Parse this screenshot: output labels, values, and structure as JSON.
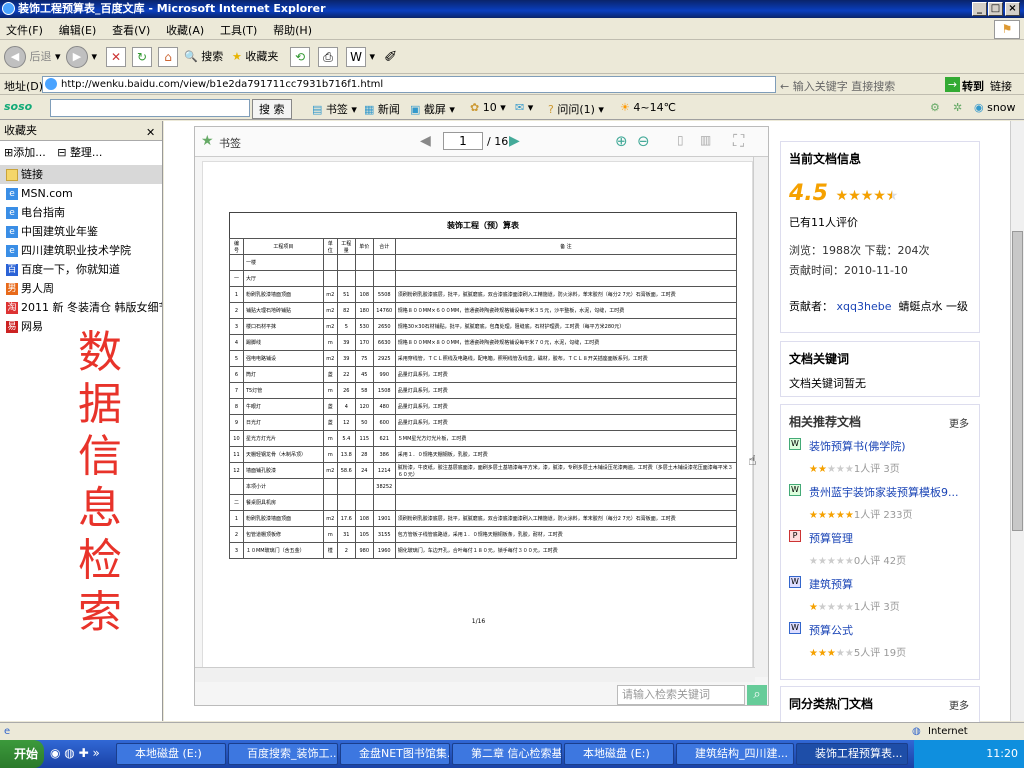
{
  "window": {
    "title": "装饰工程预算表_百度文库 - Microsoft Internet Explorer"
  },
  "menu": [
    "文件(F)",
    "编辑(E)",
    "查看(V)",
    "收藏(A)",
    "工具(T)",
    "帮助(H)"
  ],
  "toolbar": {
    "back": "后退",
    "search": "搜索",
    "favorites": "收藏夹"
  },
  "address": {
    "label": "地址(D)",
    "url": "http://wenku.baidu.com/view/b1e2da791711cc7931b716f1.html",
    "hint": "输入关键字 直接搜索",
    "go": "转到",
    "links": "链接"
  },
  "soso": {
    "logo": "soso",
    "placeholder": "",
    "search_btn": "搜 索",
    "bookmark": "书签",
    "news": "新闻",
    "screenshot": "截屏",
    "count": "10",
    "ask": "问问(1)",
    "weather": "4~14℃",
    "snow": "snow"
  },
  "favorites": {
    "title": "收藏夹",
    "add": "添加...",
    "organize": "整理...",
    "items": [
      "链接",
      "MSN.com",
      "电台指南",
      "中国建筑业年鉴",
      "四川建筑职业技术学院",
      "百度一下，你就知道",
      "男人周",
      "2011 新 冬装清仓 韩版女细节...",
      "网易"
    ]
  },
  "overlay_text": "数据信息检索",
  "viewer": {
    "bookmark": "书签",
    "page": "1",
    "total": "/ 16",
    "search_placeholder": "请输入检索关键词",
    "page_footer": "1/16"
  },
  "doc": {
    "title": "装饰工程（预）算表",
    "headers": [
      "编号",
      "工程项目",
      "单位",
      "工程量",
      "单价",
      "合计",
      "备 注"
    ],
    "rows": [
      [
        "",
        "一楼",
        "",
        "",
        "",
        "",
        ""
      ],
      [
        "一",
        "大厅",
        "",
        "",
        "",
        "",
        ""
      ],
      [
        "1",
        "粉刷乳胶漆墙面顶面",
        "m2",
        "51",
        "108",
        "5508",
        "须刷粉刷乳胶漆底层，批平，腻腻磨底，双合漆底漆面漆刷入工精施道，防火涂料，苯末胶剂（每分2 7元）石膏板面，工时费"
      ],
      [
        "2",
        "铺贴大理石地砖铺贴",
        "m2",
        "82",
        "180",
        "14760",
        "规格８００MM×６００MM，普通瓷砖陶瓷砖规格铺设每平米３５元，沙平整板，水泥，勾缝，工时费"
      ],
      [
        "3",
        "楼口石材平抹",
        "m2",
        "5",
        "530",
        "2650",
        "规格30×30石材铺贴，批平，腻腻磨底，包角处理，阻缝底，石材护理费，工时费（每平方米280元）"
      ],
      [
        "4",
        "踢脚线",
        "m",
        "39",
        "170",
        "6630",
        "规格８００MM×８００MM，普通瓷砖陶瓷砖规格铺设每平米７０元，水泥，勾缝，工时费"
      ],
      [
        "5",
        "强电电路铺设",
        "m2",
        "39",
        "75",
        "2925",
        "采用穿线管，ＴＣＬ照线及电路线，配电箱，照明线管及线盒，磁材，胶布，ＴＣＬ８开关插座面板系列，工时费"
      ],
      [
        "6",
        "筒灯",
        "盏",
        "22",
        "45",
        "990",
        "品量灯具系列，工时费"
      ],
      [
        "7",
        "T5灯管",
        "m",
        "26",
        "58",
        "1508",
        "品量灯具系列，工时费"
      ],
      [
        "8",
        "牛眼灯",
        "盏",
        "4",
        "120",
        "480",
        "品量灯具系列，工时费"
      ],
      [
        "9",
        "日光灯",
        "盏",
        "12",
        "50",
        "600",
        "品量灯具系列，工时费"
      ],
      [
        "10",
        "星光方灯光片",
        "m",
        "5.4",
        "115",
        "621",
        "５MM星光方灯光片板，工时费"
      ],
      [
        "11",
        "天棚轻钢龙骨（木制吊顶）",
        "m",
        "13.8",
        "28",
        "386",
        "采用１．０规格天棚钢板，乳胶，工时费"
      ],
      [
        "12",
        "墙面铺孔胶漆",
        "m2",
        "58.6",
        "24",
        "1214",
        "腻粉漆，牛皮纸，胶注基层底面漆，面刷多层土基墙漆每平方米，漆，腻漆，专刷多层土木铺设压花漆两遍，工时费（多层土木铺设漆花压面漆每平米３６０元）"
      ],
      [
        "",
        "本项小计",
        "",
        "",
        "",
        "38252",
        ""
      ],
      [
        "二",
        "餐桌厨具机房",
        "",
        "",
        "",
        "",
        ""
      ],
      [
        "1",
        "粉刷乳胶漆墙面顶面",
        "m2",
        "17.6",
        "108",
        "1901",
        "须刷粉刷乳胶漆底层，批平，腻腻磨底，双合漆底漆面漆刷入工精施道，防火涂料，苯末胶剂（每分2 7元）石膏板面，工时费"
      ],
      [
        "2",
        "包管道棚顶板修",
        "m",
        "31",
        "105",
        "3155",
        "包方管板子线管底路道，采用１．０规格天棚铜板条，乳胶，耐材，工时费"
      ],
      [
        "3",
        "１０MM玻璃门（含五金）",
        "樘",
        "2",
        "980",
        "1960",
        "钢化玻璃门，车边开孔，合叶每付１８０元，锁手每付３００元，工时费"
      ]
    ]
  },
  "sidebar": {
    "info_title": "当前文档信息",
    "rating": "4.5",
    "rating_fraction": 0.9,
    "rating_count": "已有11人评价",
    "stats": "浏览：1988次   下载：204次",
    "contrib_time": "贡献时间：2010-11-10",
    "contributor_label": "贡献者：",
    "contributor": "xqq3hebe",
    "level": "蜻蜓点水 一级",
    "kw_title": "文档关键词",
    "kw_text": "文档关键词暂无",
    "rec_title": "相关推荐文档",
    "more": "更多",
    "rec": [
      {
        "name": "装饰预算书(佛学院)",
        "stars": 2,
        "meta": "1人评   3页"
      },
      {
        "name": "贵州蓝宇装饰家装预算模板9...",
        "stars": 5,
        "meta": "1人评   233页"
      },
      {
        "name": "预算管理",
        "stars": 0,
        "meta": "0人评   42页"
      },
      {
        "name": "建筑预算",
        "stars": 1,
        "meta": "1人评   3页"
      },
      {
        "name": "预算公式",
        "stars": 3,
        "meta": "5人评   19页"
      }
    ],
    "hot_title": "同分类热门文档"
  },
  "status": {
    "zone": "Internet"
  },
  "taskbar": {
    "start": "开始",
    "tasks": [
      "本地磁盘 (E:)",
      "百度搜索_装饰工...",
      "金盘NET图书馆集...",
      "第二章 信心检索基",
      "本地磁盘 (E:)",
      "建筑结构_四川建...",
      "装饰工程预算表..."
    ],
    "time": "11:20"
  },
  "colors": {
    "title_bar": "#0a246a",
    "overlay_red": "#e8332a",
    "link_blue": "#1a44b6",
    "rating_orange": "#f5a100"
  }
}
